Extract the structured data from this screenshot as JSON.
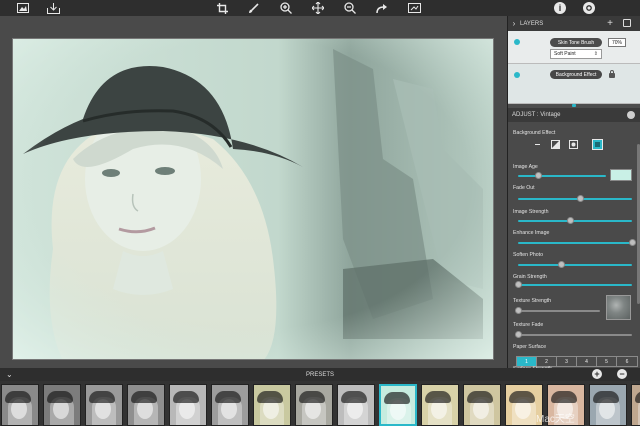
{
  "toolbar": {
    "left_icons": [
      "open-image-icon",
      "save-icon"
    ],
    "center_icons": [
      "crop-icon",
      "brush-icon",
      "zoom-in-icon",
      "move-icon",
      "zoom-out-icon",
      "redo-icon",
      "compare-icon"
    ],
    "right_icons": [
      "info-icon",
      "settings-icon"
    ],
    "info_glyph": "i"
  },
  "layers": {
    "title": "LAYERS",
    "add_glyph": "+",
    "items": [
      {
        "name": "Skin Tone Brush",
        "percent": "70%",
        "mode": "Soft Paint"
      },
      {
        "name": "Background Effect"
      }
    ]
  },
  "adjust": {
    "title": "ADJUST : Vintage",
    "effect_label": "Background Effect",
    "effect_buttons": [
      "none-icon",
      "gradient-icon",
      "radial-icon",
      "full-icon"
    ],
    "sliders": [
      {
        "label": "Image Age",
        "value": 0.23
      },
      {
        "label": "Fade Out",
        "value": 0.55
      },
      {
        "label": "Image Strength",
        "value": 0.46
      },
      {
        "label": "Enhance Image",
        "value": 1.0
      },
      {
        "label": "Soften Photo",
        "value": 0.38
      },
      {
        "label": "Grain Strength",
        "value": 0.0
      },
      {
        "label": "Texture Strength",
        "value": 0.0
      },
      {
        "label": "Texture Fade",
        "value": 0.0
      }
    ],
    "paper_surface_label": "Paper Surface",
    "paper_surface_options": [
      "1",
      "2",
      "3",
      "4",
      "5",
      "6"
    ],
    "paper_surface_selected": "1",
    "surface_strength_label": "Surface Strength",
    "age_color": "#c9f0e6"
  },
  "presets": {
    "title": "PRESETS",
    "add_glyph": "+",
    "remove_glyph": "−",
    "thumb_tints": [
      "#8a8a8a",
      "#7c7c7c",
      "#9a9a9a",
      "#8f8f8f",
      "#b8b8b8",
      "#9d9d9d",
      "#c9c9a0",
      "#a8a8a0",
      "#bdbdbd",
      "#c6ecdf",
      "#d8d2a8",
      "#cfc6a0",
      "#e6cfa0",
      "#d9b7a0",
      "#9aa7b0",
      "#bfa78f"
    ],
    "selected_index": 9
  },
  "watermark": "Mac天空",
  "accent": "#2ab8c9"
}
